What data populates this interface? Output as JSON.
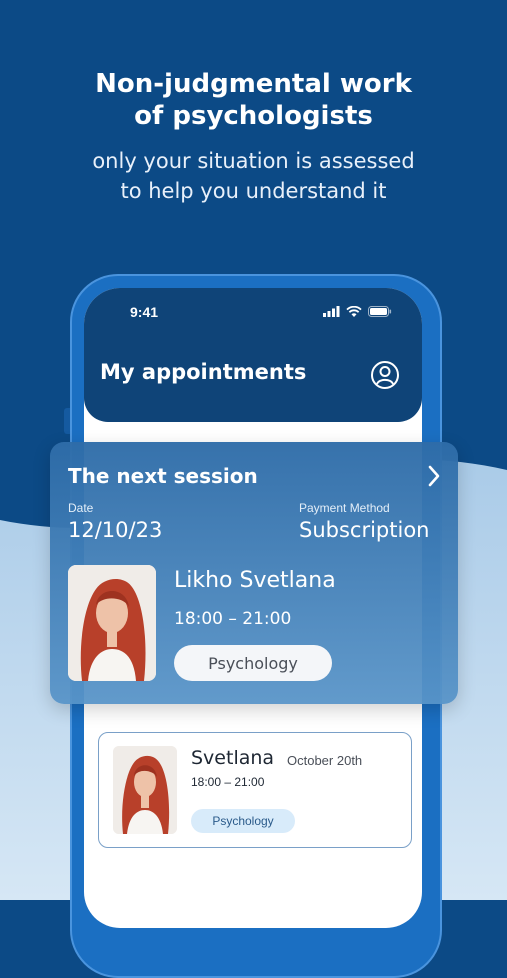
{
  "colors": {
    "background": "#0c4a86",
    "wave_light": "#a9cbe8",
    "header": "#0f4478",
    "accent_tag": "#d8ebfa"
  },
  "promo": {
    "headline_line1": "Non-judgmental work",
    "headline_line2": "of psychologists",
    "sub_line1": "only your situation is assessed",
    "sub_line2": "to help you understand it"
  },
  "status_bar": {
    "time": "9:41",
    "icons": [
      "signal-icon",
      "wifi-icon",
      "battery-icon"
    ]
  },
  "app_header": {
    "title": "My appointments",
    "profile_icon": "profile-icon"
  },
  "next_session": {
    "title": "The next session",
    "chevron_icon": "chevron-right-icon",
    "date_label": "Date",
    "date": "12/10/23",
    "payment_label": "Payment Method",
    "payment": "Subscription",
    "psychologist_name": "Likho Svetlana",
    "time": "18:00  –  21:00",
    "tag": "Psychology"
  },
  "appointments": [
    {
      "name": "Svetlana",
      "date": "October 20th",
      "time": "18:00  –  21:00",
      "tag": "Psychology"
    }
  ]
}
